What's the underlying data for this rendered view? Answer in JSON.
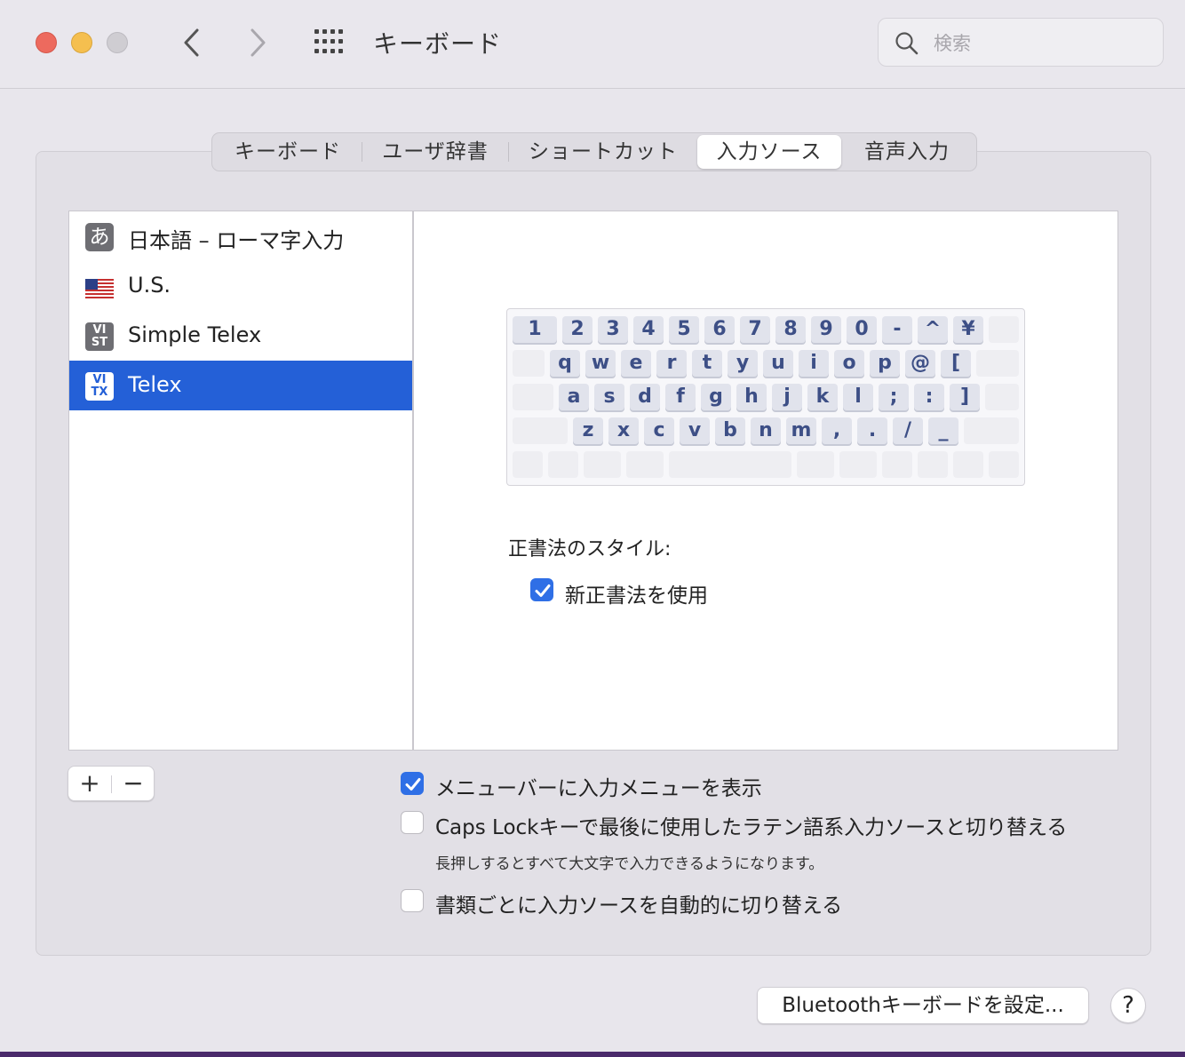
{
  "window": {
    "title": "キーボード",
    "search_placeholder": "検索"
  },
  "tabs": [
    {
      "label": "キーボード",
      "active": false
    },
    {
      "label": "ユーザ辞書",
      "active": false
    },
    {
      "label": "ショートカット",
      "active": false
    },
    {
      "label": "入力ソース",
      "active": true
    },
    {
      "label": "音声入力",
      "active": false
    }
  ],
  "sources": [
    {
      "label": "日本語 – ローマ字入力",
      "icon": "hiragana-a-icon",
      "icon_text": "あ",
      "selected": false
    },
    {
      "label": "U.S.",
      "icon": "us-flag-icon",
      "selected": false
    },
    {
      "label": "Simple Telex",
      "icon": "vi-st-icon",
      "icon_text_top": "VI",
      "icon_text_bottom": "ST",
      "selected": false
    },
    {
      "label": "Telex",
      "icon": "vi-tx-icon",
      "icon_text_top": "VI",
      "icon_text_bottom": "TX",
      "selected": true
    }
  ],
  "keyboard": {
    "row1": [
      "1",
      "2",
      "3",
      "4",
      "5",
      "6",
      "7",
      "8",
      "9",
      "0",
      "-",
      "^",
      "¥"
    ],
    "row2": [
      "q",
      "w",
      "e",
      "r",
      "t",
      "y",
      "u",
      "i",
      "o",
      "p",
      "@",
      "["
    ],
    "row3": [
      "a",
      "s",
      "d",
      "f",
      "g",
      "h",
      "j",
      "k",
      "l",
      ";",
      ":",
      "]"
    ],
    "row4": [
      "z",
      "x",
      "c",
      "v",
      "b",
      "n",
      "m",
      ",",
      ".",
      "/",
      "_"
    ]
  },
  "orthography": {
    "label": "正書法のスタイル:",
    "option_label": "新正書法を使用",
    "option_checked": true
  },
  "list_controls": {
    "add": "+",
    "remove": "−"
  },
  "options": [
    {
      "label": "メニューバーに入力メニューを表示",
      "checked": true
    },
    {
      "label": "Caps Lockキーで最後に使用したラテン語系入力ソースと切り替える",
      "checked": false,
      "sub": "長押しするとすべて大文字で入力できるようになります。"
    },
    {
      "label": "書類ごとに入力ソースを自動的に切り替える",
      "checked": false
    }
  ],
  "footer": {
    "bluetooth_button": "Bluetoothキーボードを設定...",
    "help_button": "?"
  },
  "colors": {
    "accent": "#2460d7",
    "checkbox": "#2f6fe6"
  }
}
